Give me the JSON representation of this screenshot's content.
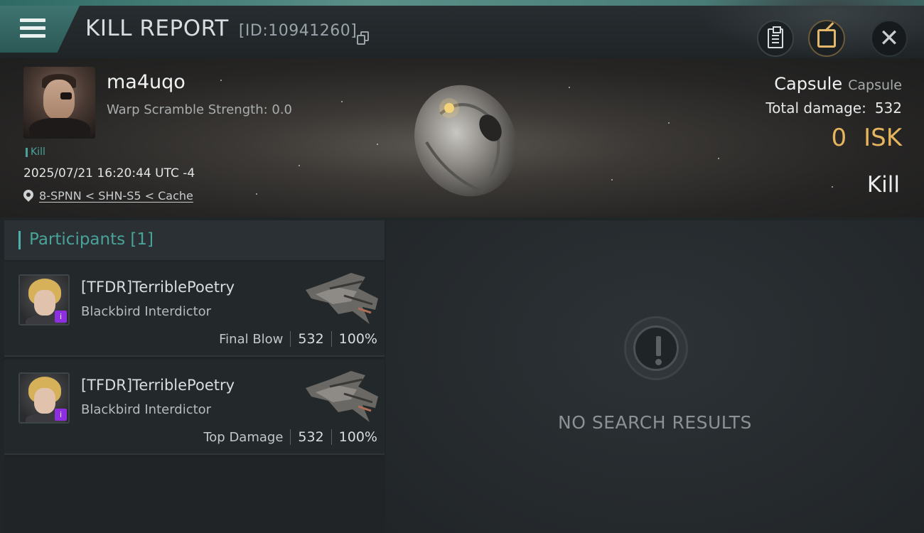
{
  "header": {
    "title": "KILL REPORT",
    "report_id": "[ID:10941260]"
  },
  "victim": {
    "name": "ma4uqo",
    "warp_scramble": "Warp Scramble Strength: 0.0",
    "tag": "Kill",
    "timestamp": "2025/07/21 16:20:44 UTC -4",
    "location": "8-SPNN < SHN-S5 < Cache",
    "ship_name": "Capsule",
    "ship_class": "Capsule",
    "total_damage_label": "Total damage:",
    "total_damage_value": "532",
    "isk_value": "0",
    "isk_unit": "ISK",
    "result": "Kill"
  },
  "participants": {
    "label": "Participants",
    "count": "[1]",
    "rows": [
      {
        "name": "[TFDR]TerriblePoetry",
        "ship": "Blackbird Interdictor",
        "role": "Final Blow",
        "damage": "532",
        "percent": "100%",
        "badge": "i"
      },
      {
        "name": "[TFDR]TerriblePoetry",
        "ship": "Blackbird Interdictor",
        "role": "Top Damage",
        "damage": "532",
        "percent": "100%",
        "badge": "i"
      }
    ]
  },
  "results_panel": {
    "empty_text": "NO SEARCH RESULTS"
  },
  "colors": {
    "accent_teal": "#4aa39a",
    "isk_gold": "#e6b55e",
    "badge_purple": "#8d2ee0"
  },
  "icons": {
    "menu": "menu-icon",
    "copy": "copy-icon",
    "clipboard": "clipboard-icon",
    "share": "share-icon",
    "close": "close-icon",
    "location": "location-pin-icon",
    "alert": "alert-icon"
  }
}
